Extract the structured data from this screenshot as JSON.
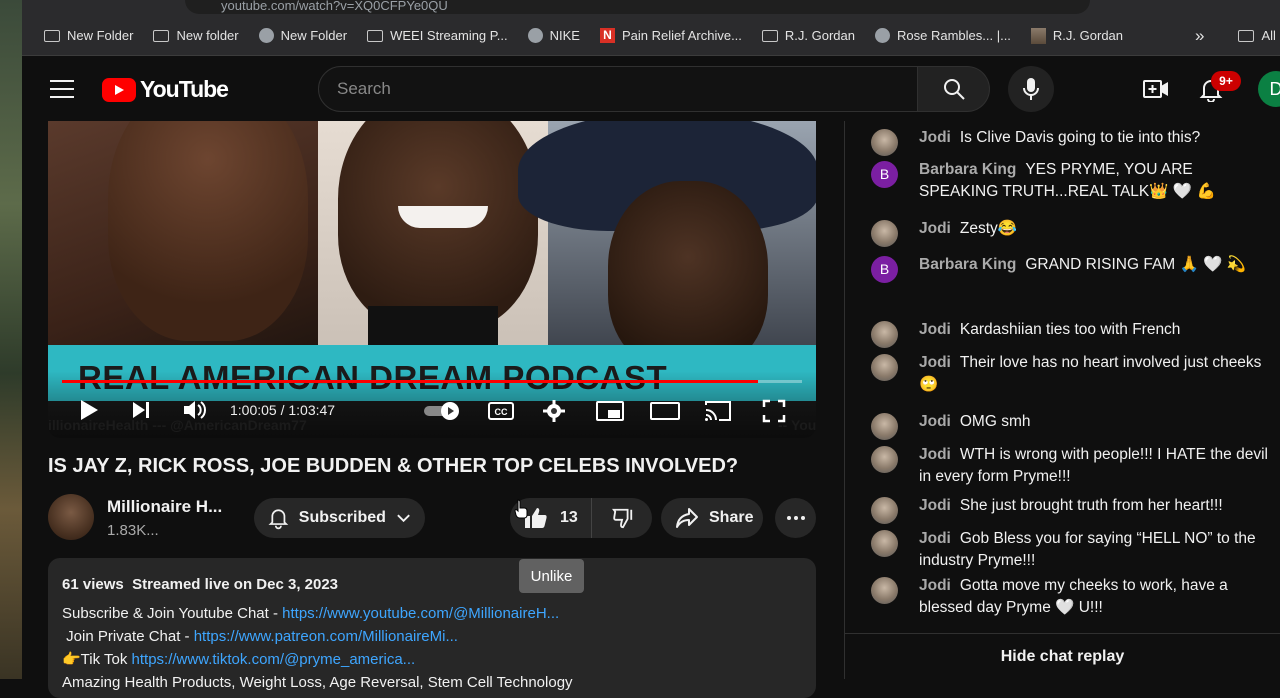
{
  "browser": {
    "url": "youtube.com/watch?v=XQ0CFPYe0QU",
    "bookmarks": [
      {
        "label": "New Folder",
        "icon": "folder-icon"
      },
      {
        "label": "New folder",
        "icon": "folder-icon"
      },
      {
        "label": "New Folder",
        "icon": "globe-icon"
      },
      {
        "label": "WEEI Streaming P...",
        "icon": "folder-icon"
      },
      {
        "label": "NIKE",
        "icon": "globe-icon"
      },
      {
        "label": "Pain Relief Archive...",
        "icon": "n-logo-icon"
      },
      {
        "label": "R.J. Gordan",
        "icon": "folder-icon"
      },
      {
        "label": "Rose Rambles... |...",
        "icon": "globe-icon"
      },
      {
        "label": "R.J. Gordan",
        "icon": "image-icon"
      }
    ],
    "bookmark_overflow": "»",
    "all_bookmarks": "All Bo"
  },
  "header": {
    "logo_text": "YouTube",
    "search_placeholder": "Search",
    "notification_count": "9+",
    "account_initial": "D"
  },
  "video": {
    "banner_text": "REAL AMERICAN DREAM PODCAST",
    "banner_sub_left": "illionaireHealth --- @AmericanDream77",
    "banner_sub_right": "-- Youtu",
    "time_current": "1:00:05",
    "time_total": "1:03:47",
    "time_display": "1:00:05 / 1:03:47",
    "progress": 0.94,
    "title": "IS JAY Z, RICK ROSS, JOE BUDDEN & OTHER TOP CELEBS INVOLVED?"
  },
  "channel": {
    "name": "Millionaire H...",
    "subscribers": "1.83K...",
    "subscribe_label": "Subscribed"
  },
  "actions": {
    "like_count": "13",
    "share_label": "Share",
    "tooltip": "Unlike"
  },
  "description": {
    "views": "61",
    "views_label": "views",
    "streamed": "Streamed live on Dec 3, 2023",
    "line1_text": "Subscribe & Join Youtube Chat - ",
    "line1_link": "https://www.youtube.com/@MillionaireH...",
    "line2_text": " Join Private Chat - ",
    "line2_link": "https://www.patreon.com/MillionaireMi...",
    "line3_text": "👉Tik Tok ",
    "line3_link": "https://www.tiktok.com/@pryme_america...",
    "line4_text": "Amazing Health Products, Weight Loss, Age Reversal, Stem Cell Technology"
  },
  "chat": {
    "messages": [
      {
        "author": "Jodi",
        "text": "Is Clive Davis going to tie into this?",
        "avatar": "photo"
      },
      {
        "author": "Barbara King",
        "text": "YES PRYME, YOU ARE SPEAKING TRUTH...REAL TALK👑 🤍 💪",
        "avatar": "B"
      },
      {
        "author": "Jodi",
        "text": "Zesty😂",
        "avatar": "photo"
      },
      {
        "author": "Barbara King",
        "text": "GRAND RISING FAM 🙏 🤍 💫",
        "avatar": "B"
      },
      {
        "author": "Jodi",
        "text": "Kardashiian ties too with French",
        "avatar": "photo"
      },
      {
        "author": "Jodi",
        "text": "Their love has no heart involved just cheeks🙄",
        "avatar": "photo"
      },
      {
        "author": "Jodi",
        "text": "OMG smh",
        "avatar": "photo"
      },
      {
        "author": "Jodi",
        "text": "WTH is wrong with people!!! I HATE the devil in every form Pryme!!!",
        "avatar": "photo"
      },
      {
        "author": "Jodi",
        "text": "She just brought truth from her heart!!!",
        "avatar": "photo"
      },
      {
        "author": "Jodi",
        "text": "Gob Bless you for saying “HELL NO” to the industry Pryme!!!",
        "avatar": "photo"
      },
      {
        "author": "Jodi",
        "text": "Gotta move my cheeks to work, have a blessed day Pryme 🤍 U!!!",
        "avatar": "photo"
      }
    ],
    "hide_label": "Hide chat replay"
  }
}
